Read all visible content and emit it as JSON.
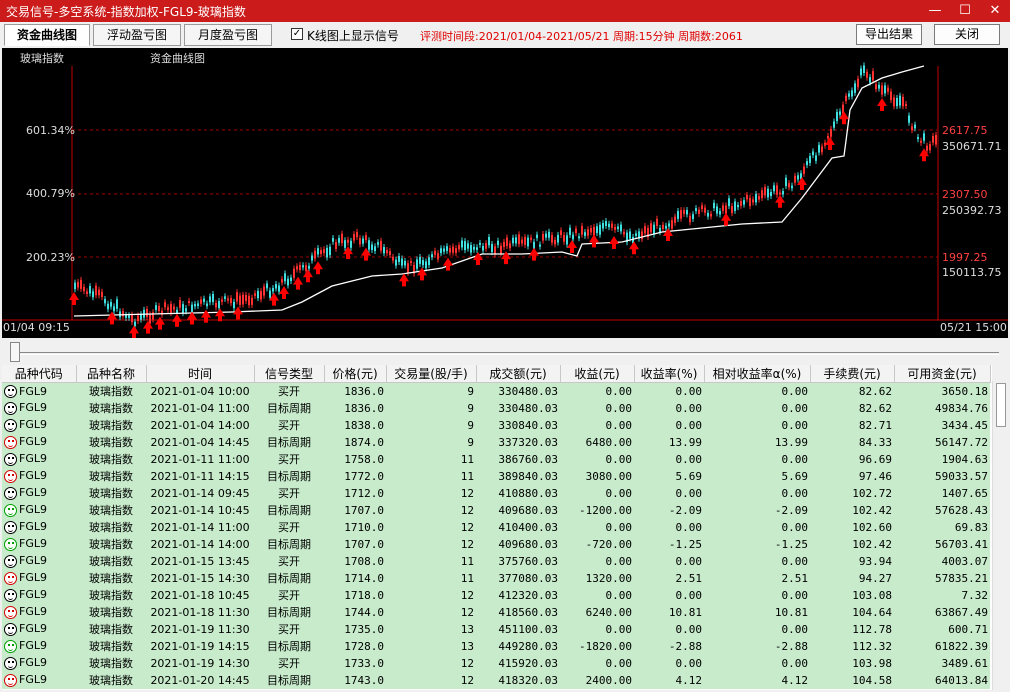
{
  "window": {
    "title": "交易信号-多空系统-指数加权-FGL9-玻璃指数",
    "min_glyph": "—",
    "max_glyph": "☐",
    "close_glyph": "✕"
  },
  "toolbar": {
    "tabs": [
      "资金曲线图",
      "浮动盈亏图",
      "月度盈亏图"
    ],
    "checkbox_label": "K线图上显示信号",
    "checkbox_mark": "✓",
    "info": "评测时间段:2021/01/04-2021/05/21  周期:15分钟  周期数:2061",
    "export_label": "导出结果",
    "close_label": "关闭"
  },
  "chart": {
    "symbol_label": "玻璃指数",
    "curve_label": "资金曲线图",
    "left_axis": [
      "601.34%",
      "400.79%",
      "200.23%"
    ],
    "right_price": [
      "2617.75",
      "2307.50",
      "1997.25"
    ],
    "right_fund": [
      "350671.71",
      "250392.73",
      "150113.75"
    ],
    "start_time": "01/04 09:15",
    "end_time": "05/21 15:00",
    "colors": {
      "bg": "#000000",
      "candle_up": "#ff3030",
      "candle_down": "#40e0e0",
      "curve": "#ffffff",
      "grid": "#a00000",
      "signal": "#ff0000"
    }
  },
  "table": {
    "headers": [
      "品种代码",
      "品种名称",
      "时间",
      "信号类型",
      "价格(元)",
      "交易量(股/手)",
      "成交额(元)",
      "收益(元)",
      "收益率(%)",
      "相对收益率α(%)",
      "手续费(元)",
      "可用资金(元)"
    ],
    "rows": [
      {
        "face": "black",
        "code": "FGL9",
        "name": "玻璃指数",
        "time": "2021-01-04 10:00",
        "type": "买开",
        "price": "1836.0",
        "qty": "9",
        "amount": "330480.03",
        "profit": "0.00",
        "rate": "0.00",
        "alpha": "0.00",
        "fee": "82.62",
        "cash": "3650.18"
      },
      {
        "face": "black",
        "code": "FGL9",
        "name": "玻璃指数",
        "time": "2021-01-04 11:00",
        "type": "目标周期",
        "price": "1836.0",
        "qty": "9",
        "amount": "330480.03",
        "profit": "0.00",
        "rate": "0.00",
        "alpha": "0.00",
        "fee": "82.62",
        "cash": "49834.76"
      },
      {
        "face": "black",
        "code": "FGL9",
        "name": "玻璃指数",
        "time": "2021-01-04 14:00",
        "type": "买开",
        "price": "1838.0",
        "qty": "9",
        "amount": "330840.03",
        "profit": "0.00",
        "rate": "0.00",
        "alpha": "0.00",
        "fee": "82.71",
        "cash": "3434.45"
      },
      {
        "face": "red",
        "code": "FGL9",
        "name": "玻璃指数",
        "time": "2021-01-04 14:45",
        "type": "目标周期",
        "price": "1874.0",
        "qty": "9",
        "amount": "337320.03",
        "profit": "6480.00",
        "rate": "13.99",
        "alpha": "13.99",
        "fee": "84.33",
        "cash": "56147.72"
      },
      {
        "face": "black",
        "code": "FGL9",
        "name": "玻璃指数",
        "time": "2021-01-11 11:00",
        "type": "买开",
        "price": "1758.0",
        "qty": "11",
        "amount": "386760.03",
        "profit": "0.00",
        "rate": "0.00",
        "alpha": "0.00",
        "fee": "96.69",
        "cash": "1904.63"
      },
      {
        "face": "red",
        "code": "FGL9",
        "name": "玻璃指数",
        "time": "2021-01-11 14:15",
        "type": "目标周期",
        "price": "1772.0",
        "qty": "11",
        "amount": "389840.03",
        "profit": "3080.00",
        "rate": "5.69",
        "alpha": "5.69",
        "fee": "97.46",
        "cash": "59033.57"
      },
      {
        "face": "black",
        "code": "FGL9",
        "name": "玻璃指数",
        "time": "2021-01-14 09:45",
        "type": "买开",
        "price": "1712.0",
        "qty": "12",
        "amount": "410880.03",
        "profit": "0.00",
        "rate": "0.00",
        "alpha": "0.00",
        "fee": "102.72",
        "cash": "1407.65"
      },
      {
        "face": "green",
        "code": "FGL9",
        "name": "玻璃指数",
        "time": "2021-01-14 10:45",
        "type": "目标周期",
        "price": "1707.0",
        "qty": "12",
        "amount": "409680.03",
        "profit": "-1200.00",
        "rate": "-2.09",
        "alpha": "-2.09",
        "fee": "102.42",
        "cash": "57628.43"
      },
      {
        "face": "black",
        "code": "FGL9",
        "name": "玻璃指数",
        "time": "2021-01-14 11:00",
        "type": "买开",
        "price": "1710.0",
        "qty": "12",
        "amount": "410400.03",
        "profit": "0.00",
        "rate": "0.00",
        "alpha": "0.00",
        "fee": "102.60",
        "cash": "69.83"
      },
      {
        "face": "green",
        "code": "FGL9",
        "name": "玻璃指数",
        "time": "2021-01-14 14:00",
        "type": "目标周期",
        "price": "1707.0",
        "qty": "12",
        "amount": "409680.03",
        "profit": "-720.00",
        "rate": "-1.25",
        "alpha": "-1.25",
        "fee": "102.42",
        "cash": "56703.41"
      },
      {
        "face": "black",
        "code": "FGL9",
        "name": "玻璃指数",
        "time": "2021-01-15 13:45",
        "type": "买开",
        "price": "1708.0",
        "qty": "11",
        "amount": "375760.03",
        "profit": "0.00",
        "rate": "0.00",
        "alpha": "0.00",
        "fee": "93.94",
        "cash": "4003.07"
      },
      {
        "face": "red",
        "code": "FGL9",
        "name": "玻璃指数",
        "time": "2021-01-15 14:30",
        "type": "目标周期",
        "price": "1714.0",
        "qty": "11",
        "amount": "377080.03",
        "profit": "1320.00",
        "rate": "2.51",
        "alpha": "2.51",
        "fee": "94.27",
        "cash": "57835.21"
      },
      {
        "face": "black",
        "code": "FGL9",
        "name": "玻璃指数",
        "time": "2021-01-18 10:45",
        "type": "买开",
        "price": "1718.0",
        "qty": "12",
        "amount": "412320.03",
        "profit": "0.00",
        "rate": "0.00",
        "alpha": "0.00",
        "fee": "103.08",
        "cash": "7.32"
      },
      {
        "face": "red",
        "code": "FGL9",
        "name": "玻璃指数",
        "time": "2021-01-18 11:30",
        "type": "目标周期",
        "price": "1744.0",
        "qty": "12",
        "amount": "418560.03",
        "profit": "6240.00",
        "rate": "10.81",
        "alpha": "10.81",
        "fee": "104.64",
        "cash": "63867.49"
      },
      {
        "face": "black",
        "code": "FGL9",
        "name": "玻璃指数",
        "time": "2021-01-19 11:30",
        "type": "买开",
        "price": "1735.0",
        "qty": "13",
        "amount": "451100.03",
        "profit": "0.00",
        "rate": "0.00",
        "alpha": "0.00",
        "fee": "112.78",
        "cash": "600.71"
      },
      {
        "face": "green",
        "code": "FGL9",
        "name": "玻璃指数",
        "time": "2021-01-19 14:15",
        "type": "目标周期",
        "price": "1728.0",
        "qty": "13",
        "amount": "449280.03",
        "profit": "-1820.00",
        "rate": "-2.88",
        "alpha": "-2.88",
        "fee": "112.32",
        "cash": "61822.39"
      },
      {
        "face": "black",
        "code": "FGL9",
        "name": "玻璃指数",
        "time": "2021-01-19 14:30",
        "type": "买开",
        "price": "1733.0",
        "qty": "12",
        "amount": "415920.03",
        "profit": "0.00",
        "rate": "0.00",
        "alpha": "0.00",
        "fee": "103.98",
        "cash": "3489.61"
      },
      {
        "face": "red",
        "code": "FGL9",
        "name": "玻璃指数",
        "time": "2021-01-20 14:45",
        "type": "目标周期",
        "price": "1743.0",
        "qty": "12",
        "amount": "418320.03",
        "profit": "2400.00",
        "rate": "4.12",
        "alpha": "4.12",
        "fee": "104.58",
        "cash": "64013.84"
      }
    ]
  }
}
